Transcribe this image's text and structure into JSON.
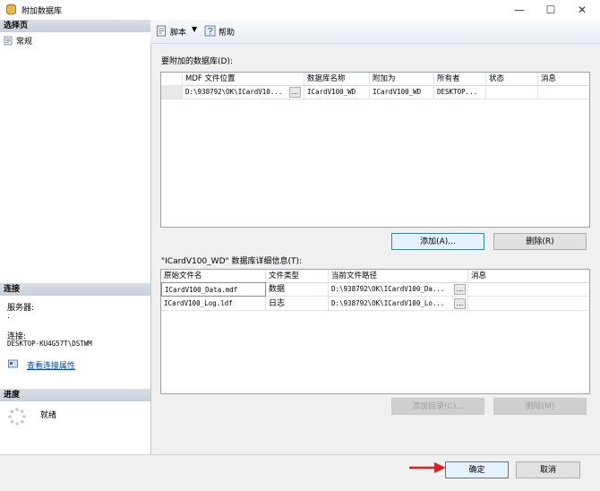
{
  "window": {
    "title": "附加数据库"
  },
  "left": {
    "select_page_header": "选择页",
    "pages": [
      {
        "label": "常规"
      }
    ],
    "connection_header": "连接",
    "server_label": "服务器:",
    "server_value": ".",
    "connection_label": "连接:",
    "connection_value": "DESKTOP-KU4G57T\\DSTWM",
    "view_props_link": "查看连接属性",
    "progress_header": "进度",
    "progress_status": "就绪"
  },
  "toolbar": {
    "script_label": "脚本",
    "help_label": "帮助"
  },
  "attach_section": {
    "label": "要附加的数据库(D):",
    "columns": [
      "MDF 文件位置",
      "数据库名称",
      "附加为",
      "所有者",
      "状态",
      "消息"
    ],
    "rows": [
      {
        "mdf": "D:\\938792\\OK\\ICardV10...",
        "dbname": "ICardV100_WD",
        "attach_as": "ICardV100_WD",
        "owner": "DESKTOP...",
        "status": "",
        "message": ""
      }
    ],
    "add_button": "添加(A)...",
    "remove_button": "删除(R)"
  },
  "details_section": {
    "label": "\"ICardV100_WD\" 数据库详细信息(T):",
    "columns": [
      "原始文件名",
      "文件类型",
      "当前文件路径",
      "消息"
    ],
    "rows": [
      {
        "filename": "ICardV100_Data.mdf",
        "type": "数据",
        "path": "D:\\938792\\OK\\ICardV100_Da...",
        "message": ""
      },
      {
        "filename": "ICardV100_Log.ldf",
        "type": "日志",
        "path": "D:\\938792\\OK\\ICardV100_Lo...",
        "message": ""
      }
    ],
    "add_catalog_button": "添加目录(C)...",
    "remove_button": "删除(M)"
  },
  "footer": {
    "ok_button": "确定",
    "cancel_button": "取消"
  },
  "colors": {
    "arrow": "#e02020",
    "accent": "#3c7fb1"
  }
}
